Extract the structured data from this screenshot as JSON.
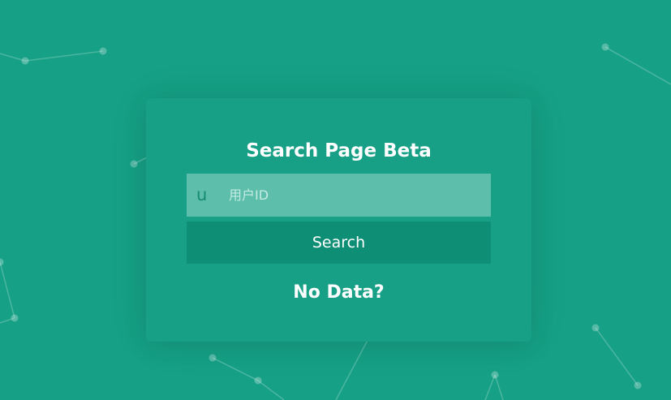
{
  "page": {
    "title": "Search Page Beta",
    "status_text": "No Data?"
  },
  "search": {
    "icon_label": "u",
    "placeholder": "用户ID",
    "value": "",
    "button_label": "Search"
  },
  "theme": {
    "background": "#16a085",
    "input_background": "#5dbfab",
    "button_background": "#0e8e74",
    "text": "#ffffff"
  },
  "icons": {
    "input_icon": "user-id-icon"
  }
}
